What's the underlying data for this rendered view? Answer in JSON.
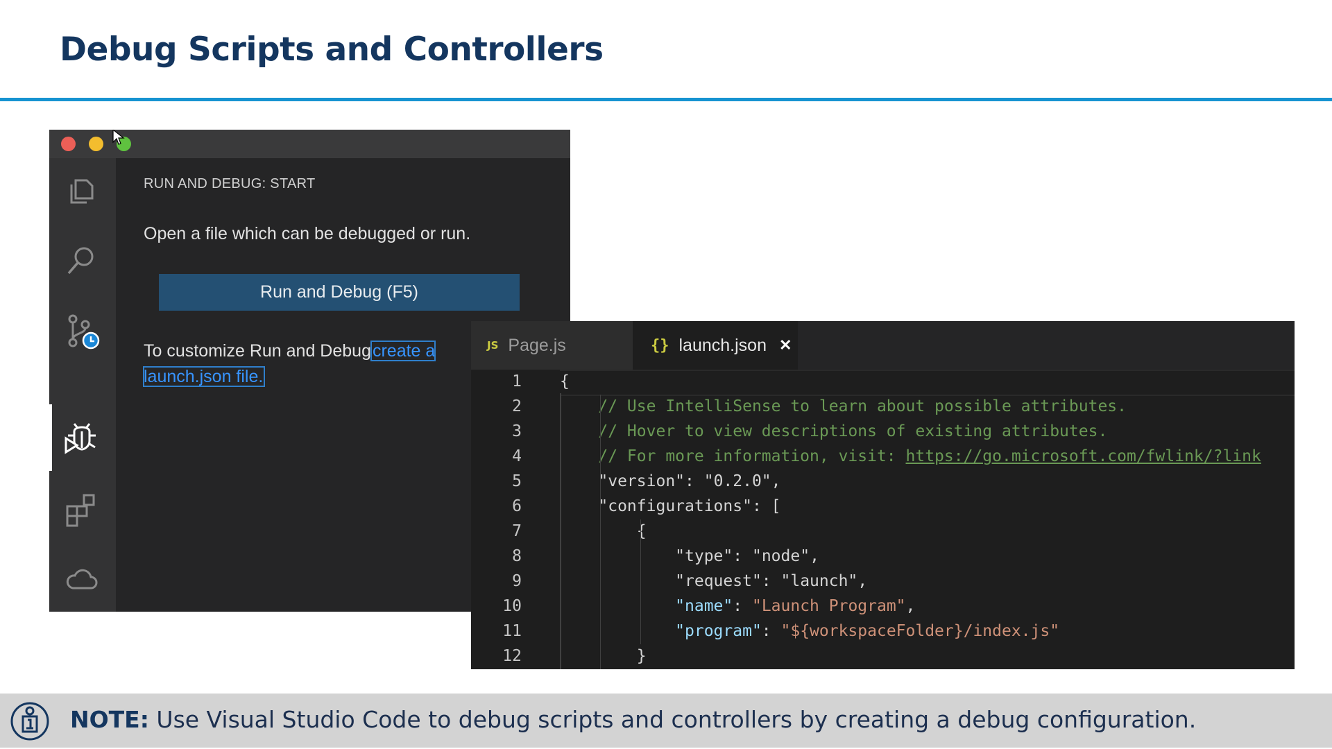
{
  "slide": {
    "title": "Debug Scripts and Controllers"
  },
  "debug_window": {
    "activity_icons": [
      "explorer-icon",
      "search-icon",
      "source-control-icon",
      "run-debug-icon",
      "extensions-icon",
      "cloud-icon"
    ],
    "heading": "RUN AND DEBUG: START",
    "message": "Open a file which can be debugged or run.",
    "run_button_label": "Run and Debug (F5)",
    "customize_prefix": "To customize Run and Debug",
    "customize_link": "create a launch.json file."
  },
  "editor": {
    "tabs": [
      {
        "icon": "JS",
        "label": "Page.js",
        "active": false
      },
      {
        "icon": "{}",
        "label": "launch.json",
        "active": true,
        "close": "✕"
      }
    ],
    "lines": [
      {
        "n": "1",
        "text": "{"
      },
      {
        "n": "2",
        "text": "    // Use IntelliSense to learn about possible attributes."
      },
      {
        "n": "3",
        "text": "    // Hover to view descriptions of existing attributes."
      },
      {
        "n": "4",
        "text": "    // For more information, visit: ",
        "link": "https://go.microsoft.com/fwlink/?link"
      },
      {
        "n": "5",
        "key": "\"version\"",
        "sep": ": ",
        "value": "\"0.2.0\"",
        "end": ","
      },
      {
        "n": "6",
        "key": "\"configurations\"",
        "sep": ": ",
        "value": "[",
        "end": ""
      },
      {
        "n": "7",
        "text": "        {"
      },
      {
        "n": "8",
        "key": "\"type\"",
        "sep": ": ",
        "value": "\"node\"",
        "end": ","
      },
      {
        "n": "9",
        "key": "\"request\"",
        "sep": ": ",
        "value": "\"launch\"",
        "end": ","
      },
      {
        "n": "10",
        "key": "\"name\"",
        "sep": ": ",
        "value": "\"Launch Program\"",
        "end": ","
      },
      {
        "n": "11",
        "key": "\"program\"",
        "sep": ": ",
        "value": "\"${workspaceFolder}/index.js\"",
        "end": ""
      },
      {
        "n": "12",
        "text": "        }"
      }
    ]
  },
  "note": {
    "label": "NOTE:",
    "text": " Use Visual Studio Code to debug scripts and controllers by creating a debug configuration."
  },
  "colors": {
    "title": "#14365f",
    "rule": "#1793d1",
    "button": "#245073",
    "link": "#3794ff",
    "comment": "#6a9955",
    "key_highlight": "#9cdcfe",
    "string_highlight": "#ce9178"
  }
}
